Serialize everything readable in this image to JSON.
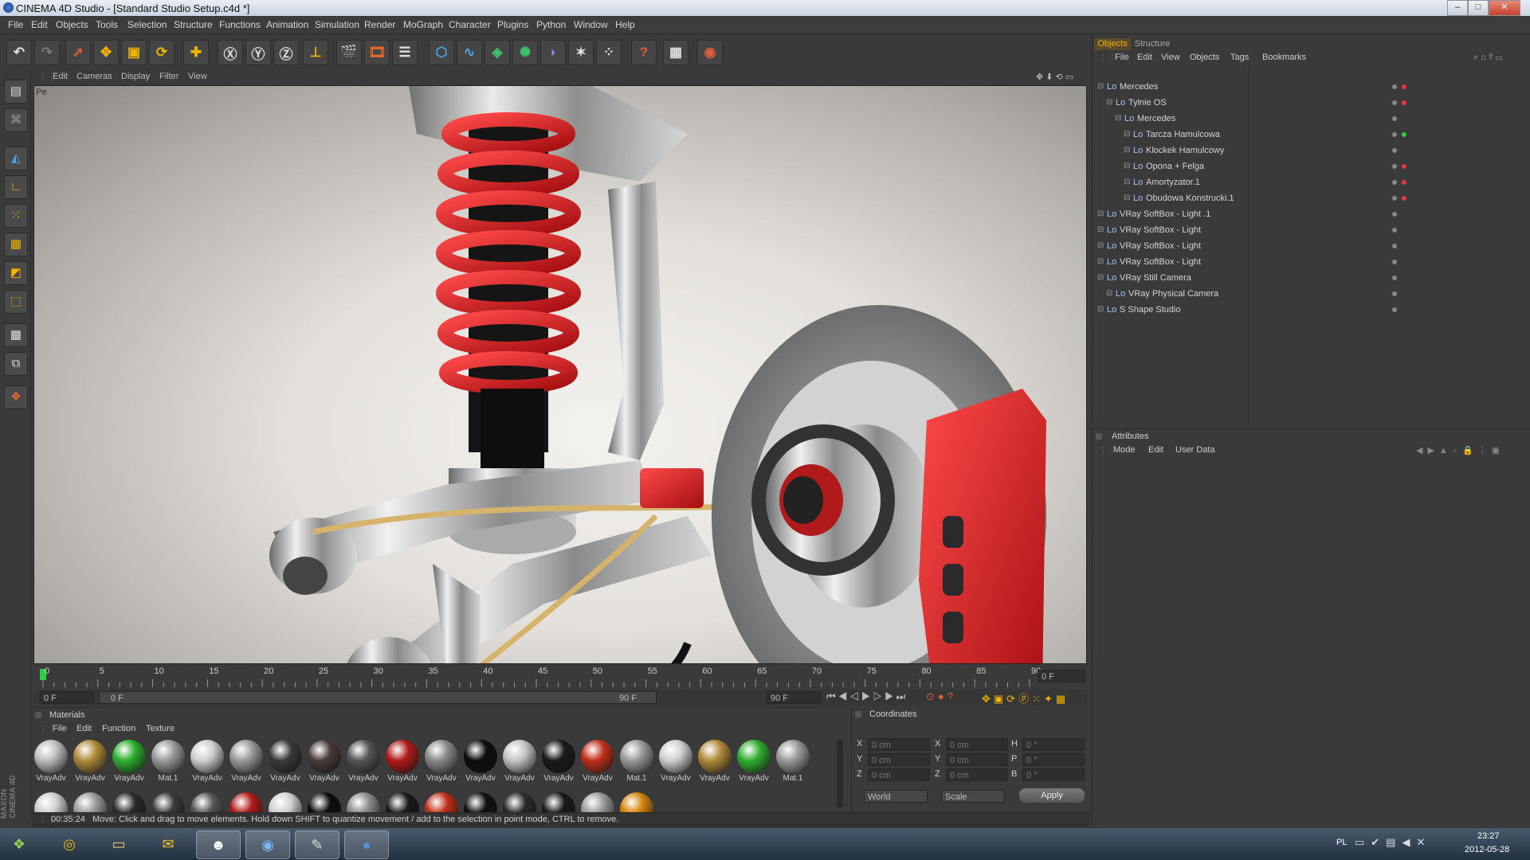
{
  "window": {
    "title": "CINEMA 4D Studio - [Standard Studio Setup.c4d *]"
  },
  "menu": [
    "File",
    "Edit",
    "Objects",
    "Tools",
    "Selection",
    "Structure",
    "Functions",
    "Animation",
    "Simulation",
    "Render",
    "MoGraph",
    "Character",
    "Plugins",
    "Python",
    "Window",
    "Help"
  ],
  "viewport": {
    "menu": [
      "Edit",
      "Cameras",
      "Display",
      "Filter",
      "View"
    ],
    "corner_label": "Pe"
  },
  "timeline": {
    "ticks": [
      "0",
      "5",
      "10",
      "15",
      "20",
      "25",
      "30",
      "35",
      "40",
      "45",
      "50",
      "55",
      "60",
      "65",
      "70",
      "75",
      "80",
      "85",
      "90"
    ],
    "current_frame": "0 F",
    "start": "0 F",
    "range_start": "0 F",
    "range_end": "90 F",
    "end": "90 F"
  },
  "materials": {
    "title": "Materials",
    "menu": [
      "File",
      "Edit",
      "Function",
      "Texture"
    ],
    "row1": [
      {
        "label": "VrayAdv",
        "color": "#bdbdbd"
      },
      {
        "label": "VrayAdv",
        "color": "#b08a3a"
      },
      {
        "label": "VrayAdv",
        "color": "#2fae2f"
      },
      {
        "label": "Mat.1",
        "color": "#9a9a9a"
      },
      {
        "label": "VrayAdv",
        "color": "#cfcfcf"
      },
      {
        "label": "VrayAdv",
        "color": "#9a9a9a"
      },
      {
        "label": "VrayAdv",
        "color": "#3a3a3a"
      },
      {
        "label": "VrayAdv",
        "color": "#4a3a3a"
      },
      {
        "label": "VrayAdv",
        "color": "#555555"
      },
      {
        "label": "VrayAdv",
        "color": "#b01a1a"
      },
      {
        "label": "VrayAdv",
        "color": "#8a8a8a"
      },
      {
        "label": "VrayAdv",
        "color": "#0d0d0d"
      },
      {
        "label": "VrayAdv",
        "color": "#c4c4c4"
      },
      {
        "label": "VrayAdv",
        "color": "#1a1a1a"
      },
      {
        "label": "VrayAdv",
        "color": "#c0301a"
      },
      {
        "label": "Mat.1",
        "color": "#9a9a9a"
      },
      {
        "label": "VrayAdv",
        "color": "#cfcfcf"
      },
      {
        "label": "VrayAdv",
        "color": "#b08a3a"
      },
      {
        "label": "VrayAdv",
        "color": "#2fae2f"
      },
      {
        "label": "Mat.1",
        "color": "#9a9a9a"
      }
    ],
    "row2": [
      "#cfcfcf",
      "#9a9a9a",
      "#2a2a2a",
      "#3a3a3a",
      "#555555",
      "#b01a1a",
      "#cfcfcf",
      "#0d0d0d",
      "#8a8a8a",
      "#1a1a1a",
      "#c0301a",
      "#111111",
      "#2a2a2a",
      "#1a1a1a",
      "#9a9a9a",
      "#d4850a"
    ]
  },
  "coordinates": {
    "title": "Coordinates",
    "rows": [
      {
        "a": "X",
        "av": "0 cm",
        "b": "X",
        "bv": "0 cm",
        "c": "H",
        "cv": "0 °"
      },
      {
        "a": "Y",
        "av": "0 cm",
        "b": "Y",
        "bv": "0 cm",
        "c": "P",
        "cv": "0 °"
      },
      {
        "a": "Z",
        "av": "0 cm",
        "b": "Z",
        "bv": "0 cm",
        "c": "B",
        "cv": "0 °"
      }
    ],
    "world": "World",
    "scale": "Scale",
    "apply": "Apply"
  },
  "objects": {
    "tabs": [
      "Objects",
      "Structure"
    ],
    "menu": [
      "File",
      "Edit",
      "View",
      "Objects",
      "Tags",
      "Bookmarks"
    ],
    "items": [
      {
        "name": "Mercedes",
        "indent": 0
      },
      {
        "name": "Tylnie OS",
        "indent": 1
      },
      {
        "name": "Mercedes",
        "indent": 2
      },
      {
        "name": "Tarcza Hamulcowa",
        "indent": 3
      },
      {
        "name": "Klockek Hamulcowy",
        "indent": 3
      },
      {
        "name": "Opona + Felga",
        "indent": 3
      },
      {
        "name": "Amortyzator.1",
        "indent": 3
      },
      {
        "name": "Obudowa Konstrucki.1",
        "indent": 3
      },
      {
        "name": "VRay SoftBox - Light .1",
        "indent": 0
      },
      {
        "name": "VRay SoftBox - Light",
        "indent": 0
      },
      {
        "name": "VRay SoftBox - Light",
        "indent": 0
      },
      {
        "name": "VRay SoftBox - Light",
        "indent": 0
      },
      {
        "name": "VRay Still Camera",
        "indent": 0
      },
      {
        "name": "VRay Physical Camera",
        "indent": 1
      },
      {
        "name": "S Shape Studio",
        "indent": 0
      }
    ]
  },
  "attributes": {
    "title": "Attributes",
    "menu": [
      "Mode",
      "Edit",
      "User Data"
    ]
  },
  "status": {
    "time": "00:35:24",
    "message": "Move: Click and drag to move elements. Hold down SHIFT to quantize movement / add to the selection in point mode, CTRL to remove."
  },
  "brand": "MAXON CINEMA 4D",
  "taskbar": {
    "lang": "PL",
    "time": "23:27",
    "date": "2012-05-28"
  }
}
